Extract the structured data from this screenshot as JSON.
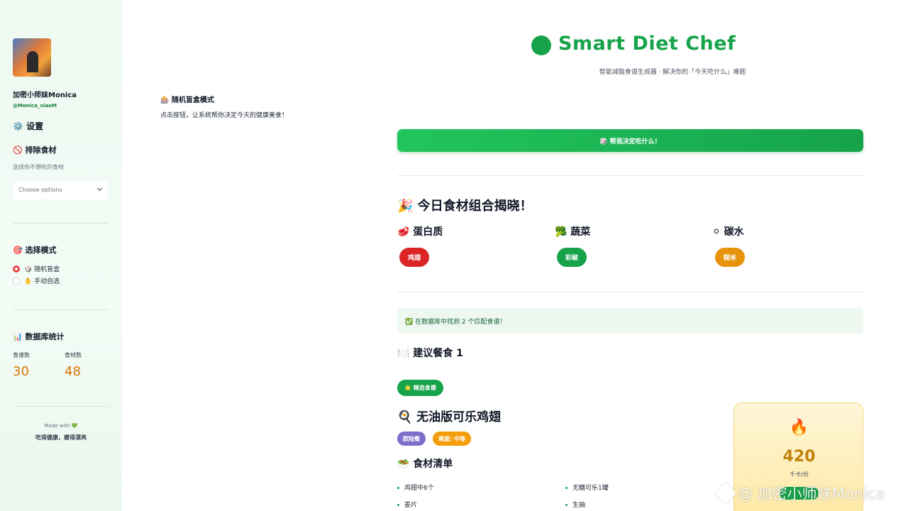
{
  "sidebar": {
    "user_name": "加密小师妹Monica",
    "user_handle": "@Monica_xiaoM",
    "settings_label": "⚙️ 设置",
    "exclude_title": "🚫 排除食材",
    "exclude_help": "选择你不想吃的食材",
    "exclude_placeholder": "Choose options",
    "mode_title": "🎯 选择模式",
    "mode_options": [
      {
        "label": "🎲 随机盲盒",
        "selected": true
      },
      {
        "label": "✋ 手动自选",
        "selected": false
      }
    ],
    "stats_title": "📊 数据库统计",
    "stats": [
      {
        "label": "食谱数",
        "value": "30"
      },
      {
        "label": "食材数",
        "value": "48"
      }
    ],
    "made_with": "Made with 💚",
    "slogan": "吃得健康，瘦得漂亮"
  },
  "main": {
    "mode_title": "🎰 随机盲盒模式",
    "mode_desc": "点击按钮，让系统帮你决定今天的健康美食！",
    "app_title": "Smart Diet Chef",
    "app_subtitle": "智能减脂食谱生成器 · 解决你的「今天吃什么」难题",
    "decide_button": "🎲 帮我决定吃什么！",
    "reveal_title": "🎉 今日食材组合揭晓！",
    "categories": [
      {
        "title": "🥩 蛋白质",
        "item": "鸡翅",
        "color": "#dc2626"
      },
      {
        "title": "🥦 蔬菜",
        "item": "彩椒",
        "color": "#16a34a"
      },
      {
        "title": "⚪ 碳水",
        "item": "糙米",
        "color": "#e8930c"
      }
    ],
    "found_message": "✅ 在数据库中找到 2 个匹配食谱！",
    "meal_title": "🍽️ 建议餐食 1",
    "featured_badge": "⭐ 精选食谱",
    "dish_title": "🍳 无油版可乐鸡翅",
    "tags": [
      "欧陆餐",
      "难度: 中等"
    ],
    "ingredients_title": "🥗 食材清单",
    "ingredients": [
      "鸡翅中6个",
      "无糖可乐1罐",
      "姜片",
      "生抽"
    ],
    "calories": {
      "icon": "🔥",
      "value": "420",
      "unit": "千卡/份"
    }
  },
  "watermark": "@ 加密小师妹Monica",
  "colors": {
    "brand": "#16a34a",
    "accent": "#d97706"
  }
}
